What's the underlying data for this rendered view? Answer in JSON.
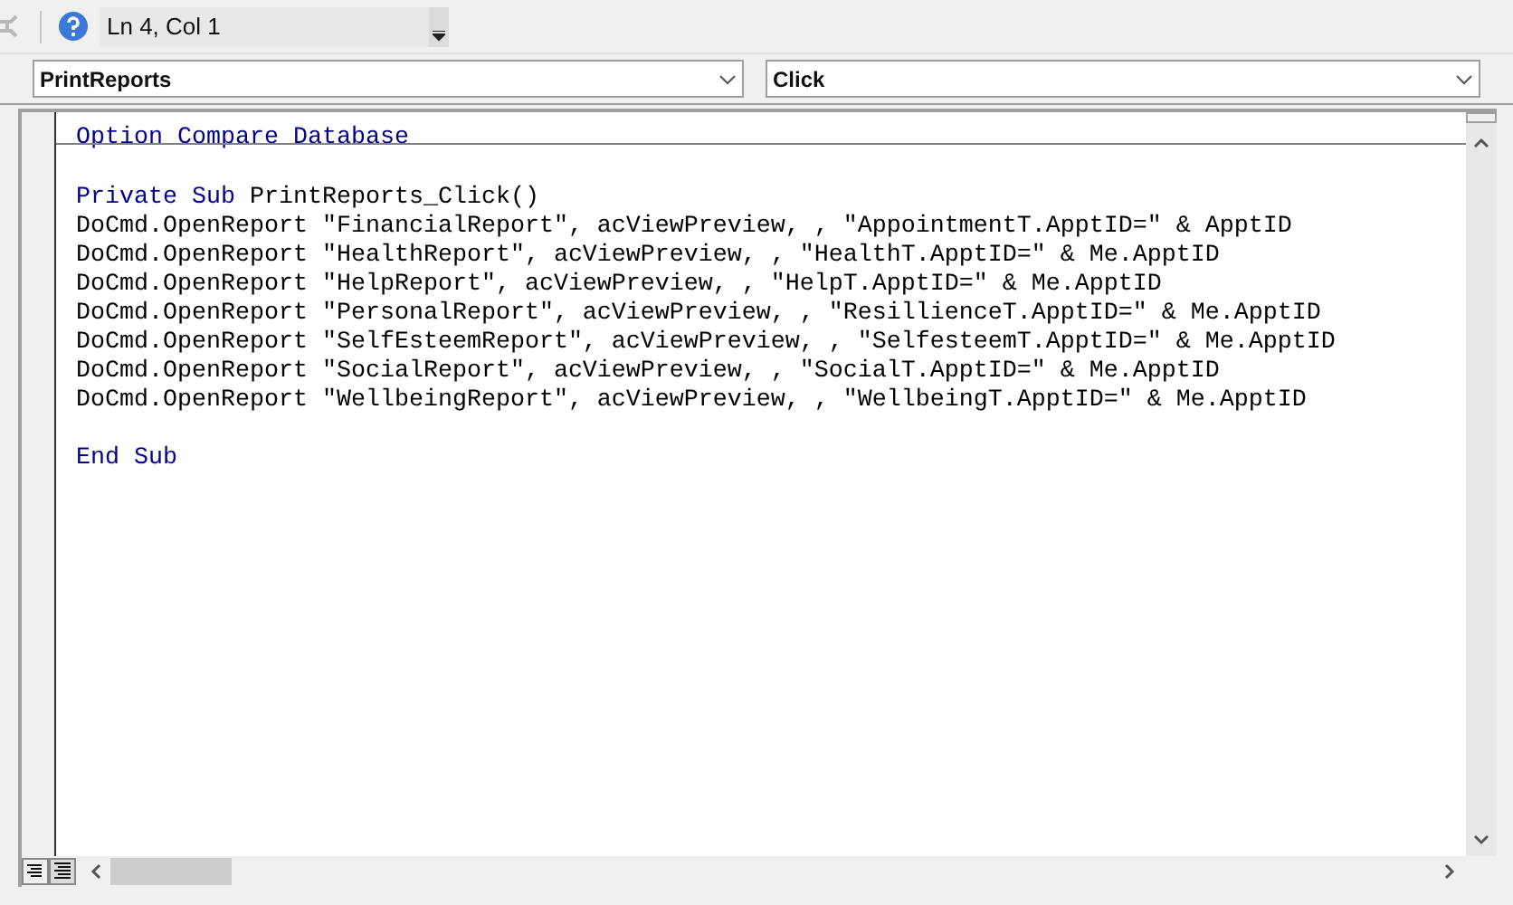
{
  "toolbar": {
    "position": "Ln 4, Col 1"
  },
  "object_dropdown": {
    "value": "PrintReports"
  },
  "procedure_dropdown": {
    "value": "Click"
  },
  "procedures": [
    {
      "lines": [
        {
          "kind": "code",
          "tokens": [
            {
              "text": "Option Compare Database",
              "kind": "keyword"
            }
          ]
        }
      ]
    },
    {
      "lines": [
        {
          "kind": "blank"
        },
        {
          "kind": "code",
          "tokens": [
            {
              "text": "Private Sub",
              "kind": "keyword"
            },
            {
              "text": " PrintReports_Click()",
              "kind": "plain"
            }
          ]
        },
        {
          "kind": "code",
          "tokens": [
            {
              "text": "DoCmd.OpenReport \"FinancialReport\", acViewPreview, , \"AppointmentT.ApptID=\" & ApptID",
              "kind": "plain"
            }
          ]
        },
        {
          "kind": "code",
          "tokens": [
            {
              "text": "DoCmd.OpenReport \"HealthReport\", acViewPreview, , \"HealthT.ApptID=\" & Me.ApptID",
              "kind": "plain"
            }
          ]
        },
        {
          "kind": "code",
          "tokens": [
            {
              "text": "DoCmd.OpenReport \"HelpReport\", acViewPreview, , \"HelpT.ApptID=\" & Me.ApptID",
              "kind": "plain"
            }
          ]
        },
        {
          "kind": "code",
          "tokens": [
            {
              "text": "DoCmd.OpenReport \"PersonalReport\", acViewPreview, , \"ResillienceT.ApptID=\" & Me.ApptID",
              "kind": "plain"
            }
          ]
        },
        {
          "kind": "code",
          "tokens": [
            {
              "text": "DoCmd.OpenReport \"SelfEsteemReport\", acViewPreview, , \"SelfesteemT.ApptID=\" & Me.ApptID",
              "kind": "plain"
            }
          ]
        },
        {
          "kind": "code",
          "tokens": [
            {
              "text": "DoCmd.OpenReport \"SocialReport\", acViewPreview, , \"SocialT.ApptID=\" & Me.ApptID",
              "kind": "plain"
            }
          ]
        },
        {
          "kind": "code",
          "tokens": [
            {
              "text": "DoCmd.OpenReport \"WellbeingReport\", acViewPreview, , \"WellbeingT.ApptID=\" & Me.ApptID",
              "kind": "plain"
            }
          ]
        },
        {
          "kind": "blank"
        },
        {
          "kind": "code",
          "tokens": [
            {
              "text": "End Sub",
              "kind": "keyword"
            }
          ]
        }
      ]
    }
  ]
}
